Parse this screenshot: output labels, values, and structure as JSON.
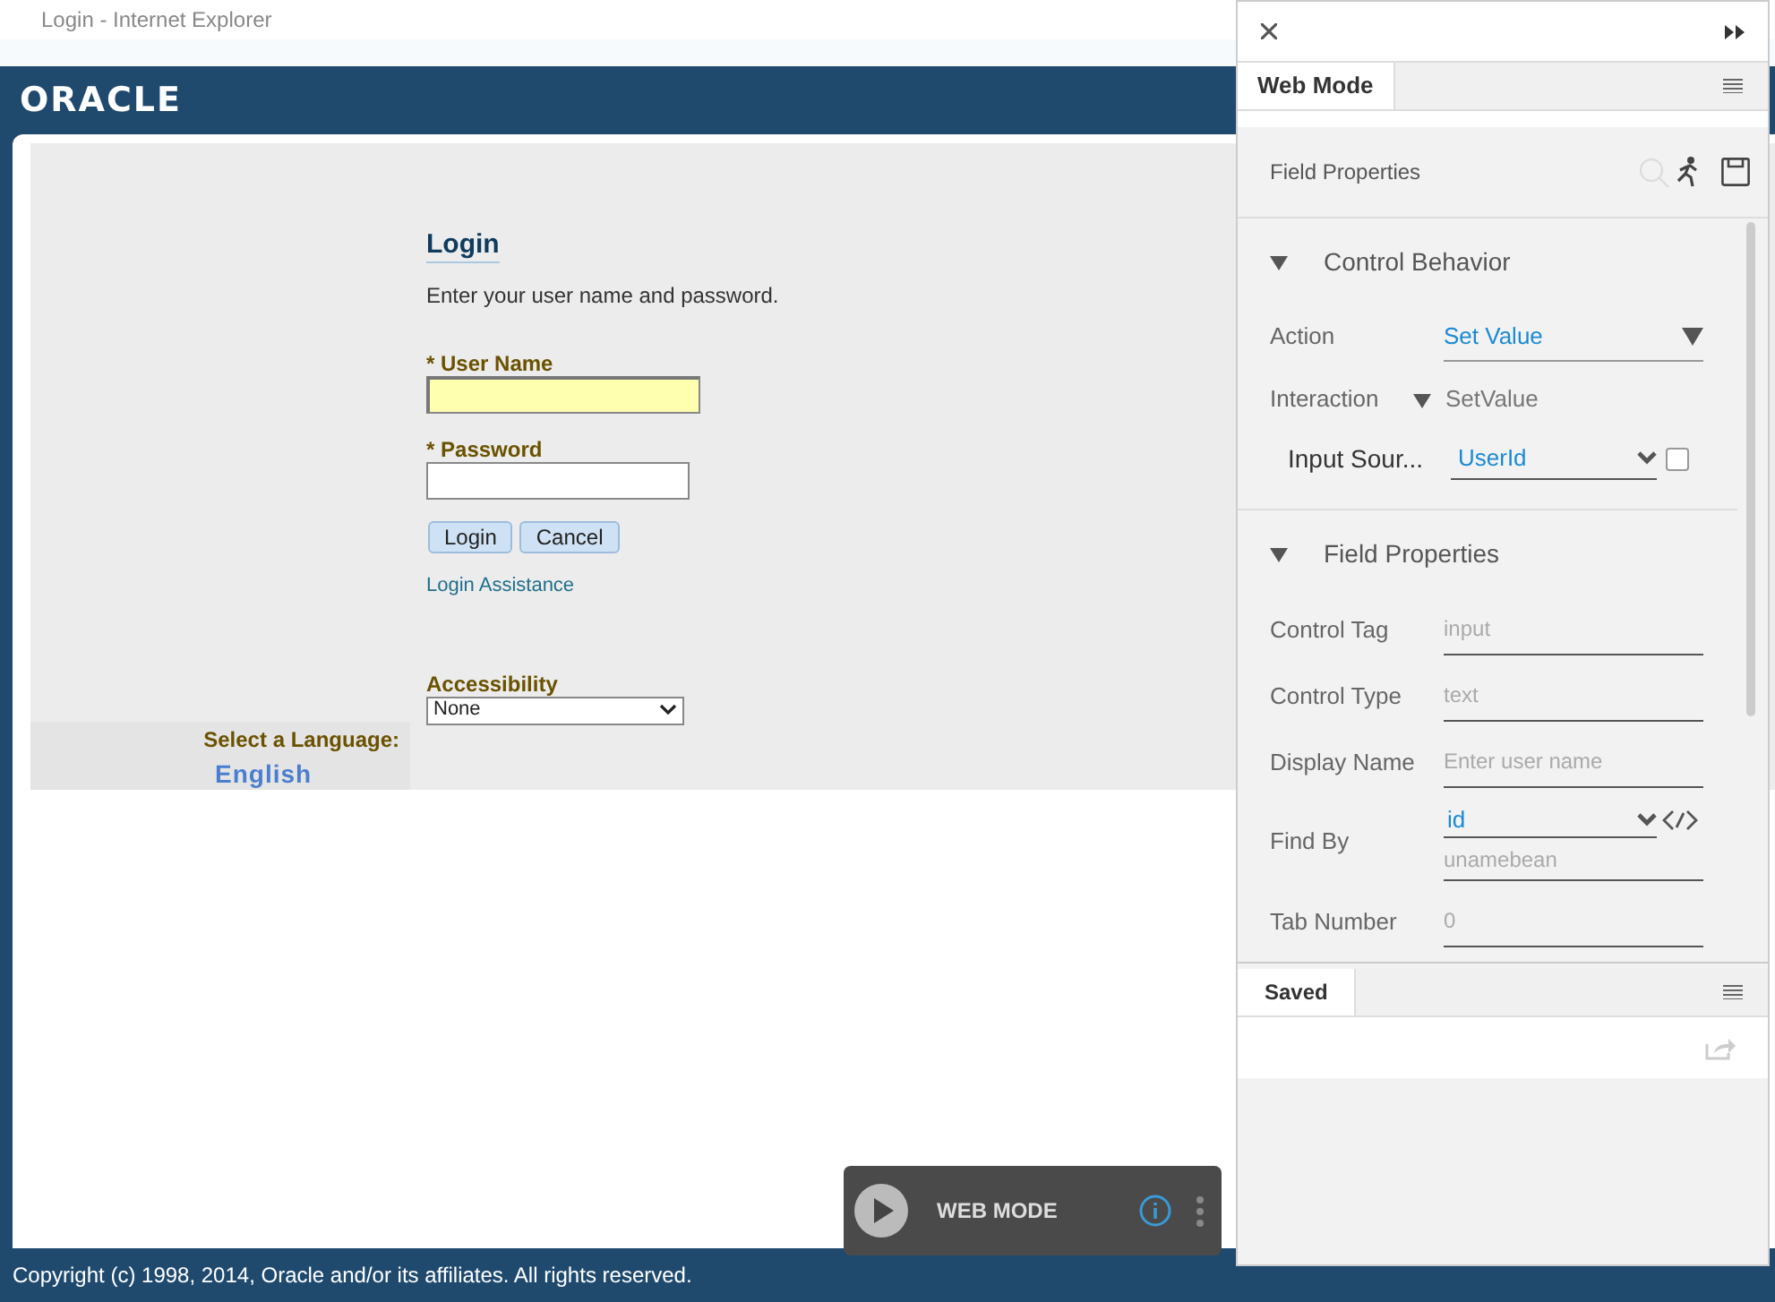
{
  "window": {
    "title": "Login - Internet Explorer"
  },
  "header": {
    "logo": "ORACLE"
  },
  "login": {
    "title": "Login",
    "instruction": "Enter your user name and password.",
    "fields": [
      {
        "mark": "*",
        "label": "User Name",
        "highlighted": true
      },
      {
        "mark": "*",
        "label": "Password",
        "highlighted": false
      }
    ],
    "buttons": [
      "Login",
      "Cancel"
    ],
    "link": "Login Assistance",
    "accessibility": {
      "label": "Accessibility",
      "value": "None"
    }
  },
  "language": {
    "label": "Select a Language:",
    "value": "English"
  },
  "footer": "Copyright (c) 1998, 2014, Oracle and/or its affiliates. All rights reserved.",
  "player": {
    "label": "WEB MODE"
  },
  "panel": {
    "tabs": [
      {
        "label": "Web Mode",
        "selected": true
      }
    ],
    "toolbar_title": "Field Properties",
    "sections": [
      {
        "title": "Control Behavior",
        "expanded": true,
        "rows": [
          {
            "kind": "select",
            "label": "Action",
            "value": "Set Value"
          },
          {
            "kind": "static",
            "label": "Interaction",
            "value": "SetValue"
          },
          {
            "kind": "select_checkbox",
            "label": "Input Sour...",
            "value": "UserId",
            "checked": false
          }
        ]
      },
      {
        "title": "Field Properties",
        "expanded": true,
        "rows": [
          {
            "kind": "field",
            "label": "Control Tag",
            "value": "input"
          },
          {
            "kind": "field",
            "label": "Control Type",
            "value": "text"
          },
          {
            "kind": "field",
            "label": "Display Name",
            "value": "Enter user name"
          },
          {
            "kind": "find_by",
            "label": "Find By",
            "value": "id",
            "detail": "unamebean"
          },
          {
            "kind": "field",
            "label": "Tab Number",
            "value": "0"
          }
        ]
      }
    ],
    "saved_tabs": [
      {
        "label": "Saved",
        "selected": true
      }
    ]
  }
}
